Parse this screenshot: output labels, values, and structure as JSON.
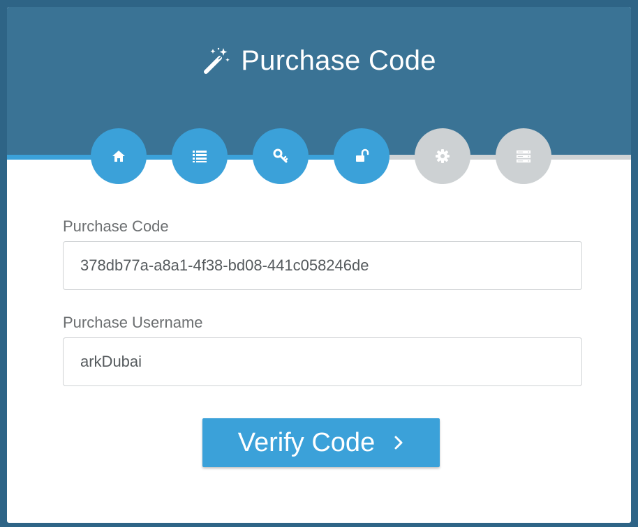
{
  "header": {
    "title": "Purchase Code",
    "title_icon": "magic-wand-icon"
  },
  "steps": [
    {
      "icon": "home-icon",
      "status": "done"
    },
    {
      "icon": "list-icon",
      "status": "done"
    },
    {
      "icon": "key-icon",
      "status": "done"
    },
    {
      "icon": "unlock-icon",
      "status": "current"
    },
    {
      "icon": "gear-icon",
      "status": "todo"
    },
    {
      "icon": "server-icon",
      "status": "todo"
    }
  ],
  "form": {
    "purchase_code_label": "Purchase Code",
    "purchase_code_value": "378db77a-a8a1-4f38-bd08-441c058246de",
    "purchase_username_label": "Purchase Username",
    "purchase_username_value": "arkDubai"
  },
  "verify_button": {
    "label": "Verify Code",
    "icon": "chevron-right-icon"
  },
  "colors": {
    "page_background": "#2e6486",
    "header_background": "#3a7395",
    "accent": "#3ba1d9",
    "step_inactive": "#cdd1d3",
    "track_inactive": "#cfd3d5"
  }
}
